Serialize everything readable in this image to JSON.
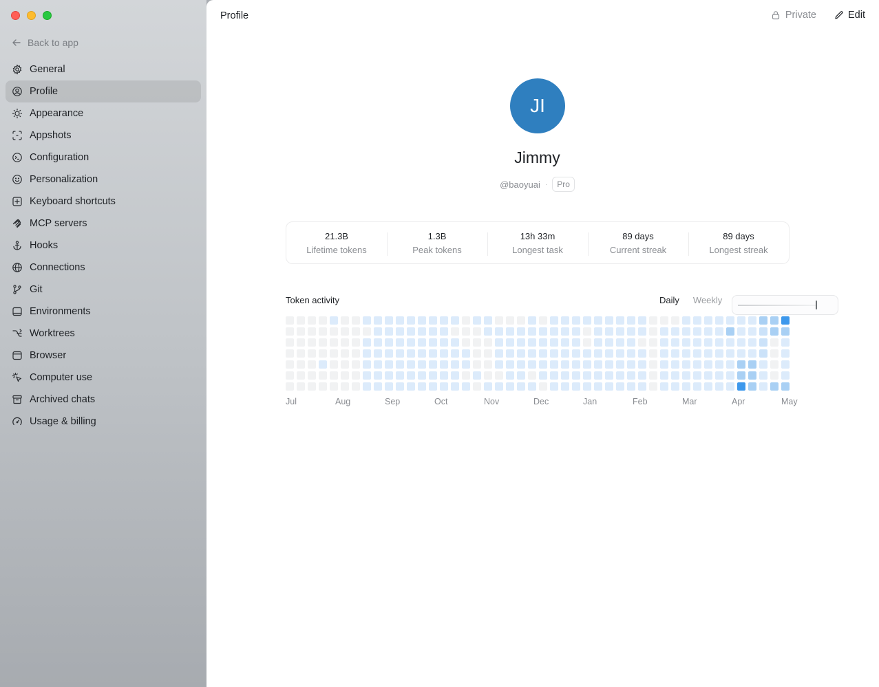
{
  "sidebar": {
    "back_label": "Back to app",
    "items": [
      {
        "label": "General",
        "icon": "gear-icon",
        "active": false
      },
      {
        "label": "Profile",
        "icon": "user-circle-icon",
        "active": true
      },
      {
        "label": "Appearance",
        "icon": "sun-icon",
        "active": false
      },
      {
        "label": "Appshots",
        "icon": "capture-icon",
        "active": false
      },
      {
        "label": "Configuration",
        "icon": "config-icon",
        "active": false
      },
      {
        "label": "Personalization",
        "icon": "smile-icon",
        "active": false
      },
      {
        "label": "Keyboard shortcuts",
        "icon": "keyboard-icon",
        "active": false
      },
      {
        "label": "MCP servers",
        "icon": "mcp-icon",
        "active": false
      },
      {
        "label": "Hooks",
        "icon": "anchor-icon",
        "active": false
      },
      {
        "label": "Connections",
        "icon": "globe-icon",
        "active": false
      },
      {
        "label": "Git",
        "icon": "git-branch-icon",
        "active": false
      },
      {
        "label": "Environments",
        "icon": "monitor-icon",
        "active": false
      },
      {
        "label": "Worktrees",
        "icon": "worktree-icon",
        "active": false
      },
      {
        "label": "Browser",
        "icon": "browser-icon",
        "active": false
      },
      {
        "label": "Computer use",
        "icon": "cursor-click-icon",
        "active": false
      },
      {
        "label": "Archived chats",
        "icon": "archive-icon",
        "active": false
      },
      {
        "label": "Usage & billing",
        "icon": "gauge-icon",
        "active": false
      }
    ]
  },
  "header": {
    "title": "Profile",
    "private_label": "Private",
    "edit_label": "Edit"
  },
  "profile": {
    "initials": "JI",
    "name": "Jimmy",
    "handle": "@baoyuai",
    "separator": "·",
    "plan": "Pro",
    "avatar_color": "#2f7fbf"
  },
  "stats": [
    {
      "value": "21.3B",
      "label": "Lifetime tokens"
    },
    {
      "value": "1.3B",
      "label": "Peak tokens"
    },
    {
      "value": "13h 33m",
      "label": "Longest task"
    },
    {
      "value": "89 days",
      "label": "Current streak"
    },
    {
      "value": "89 days",
      "label": "Longest streak"
    }
  ],
  "activity": {
    "title": "Token activity",
    "toggle_daily": "Daily",
    "toggle_weekly": "Weekly",
    "selected_toggle": "Daily",
    "months": [
      "Jul",
      "Aug",
      "Sep",
      "Oct",
      "Nov",
      "Dec",
      "Jan",
      "Feb",
      "Mar",
      "Apr",
      "May"
    ],
    "level_colors": [
      "#f1f2f3",
      "#dcebfb",
      "#cbe2f9",
      "#a9d0f4",
      "#3d98ec"
    ]
  },
  "chart_data": {
    "type": "heatmap",
    "title": "Token activity",
    "x_labels": [
      "Jul",
      "Aug",
      "Sep",
      "Oct",
      "Nov",
      "Dec",
      "Jan",
      "Feb",
      "Mar",
      "Apr",
      "May"
    ],
    "weeks": 46,
    "days_per_week": 7,
    "levels": [
      "0000000",
      "0000000",
      "0000000",
      "0000100",
      "1000000",
      "0000000",
      "0000000",
      "1011111",
      "1111111",
      "1111111",
      "1111111",
      "1111111",
      "1111111",
      "1111111",
      "1111111",
      "1011111",
      "0001101",
      "1000010",
      "1100001",
      "0111101",
      "0111111",
      "0111111",
      "1111101",
      "0111110",
      "1111111",
      "1111111",
      "1111111",
      "1001111",
      "1111111",
      "1111111",
      "1111111",
      "1111111",
      "1101111",
      "0000000",
      "0111111",
      "0111111",
      "1111111",
      "1111111",
      "1111111",
      "1111111",
      "1311111",
      "1111334",
      "1111333",
      "3222111",
      "3300003",
      "4311113"
    ]
  }
}
